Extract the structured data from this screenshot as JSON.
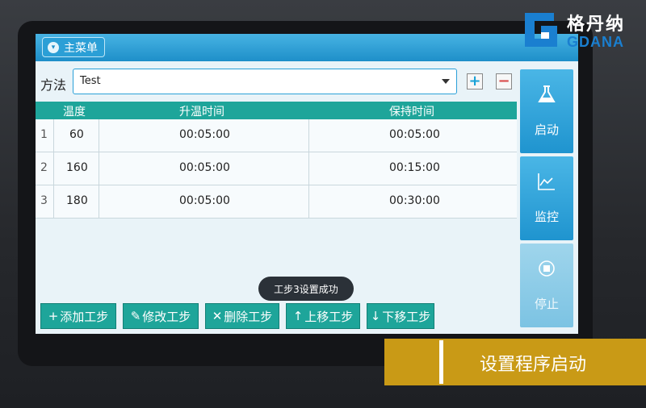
{
  "topbar": {
    "menu_label": "主菜单",
    "menu_icon": "circle-chevron-down-icon"
  },
  "method": {
    "label": "方法",
    "value": "Test",
    "add_icon": "plus-icon",
    "remove_icon": "minus-icon"
  },
  "table": {
    "headers": [
      "温度",
      "升温时间",
      "保持时间"
    ],
    "rows": [
      {
        "index": "1",
        "temp": "60",
        "ramp": "00:05:00",
        "hold": "00:05:00"
      },
      {
        "index": "2",
        "temp": "160",
        "ramp": "00:05:00",
        "hold": "00:15:00"
      },
      {
        "index": "3",
        "temp": "180",
        "ramp": "00:05:00",
        "hold": "00:30:00"
      }
    ]
  },
  "side_buttons": [
    {
      "label": "启动",
      "icon": "flask-icon"
    },
    {
      "label": "监控",
      "icon": "line-chart-icon"
    },
    {
      "label": "停止",
      "icon": "stop-icon"
    }
  ],
  "toast": "工步3设置成功",
  "bottom_buttons": [
    {
      "label": "添加工步",
      "icon": "plus-icon"
    },
    {
      "label": "修改工步",
      "icon": "pencil-icon"
    },
    {
      "label": "删除工步",
      "icon": "x-icon"
    },
    {
      "label": "上移工步",
      "icon": "arrow-up-icon"
    },
    {
      "label": "下移工步",
      "icon": "arrow-down-icon"
    }
  ],
  "logo": {
    "cn": "格丹纳",
    "en": "GDANA"
  },
  "caption": "设置程序启动",
  "colors": {
    "accent_blue": "#1e8fc9",
    "teal": "#1ea59a",
    "caption_gold": "#c99a16"
  }
}
